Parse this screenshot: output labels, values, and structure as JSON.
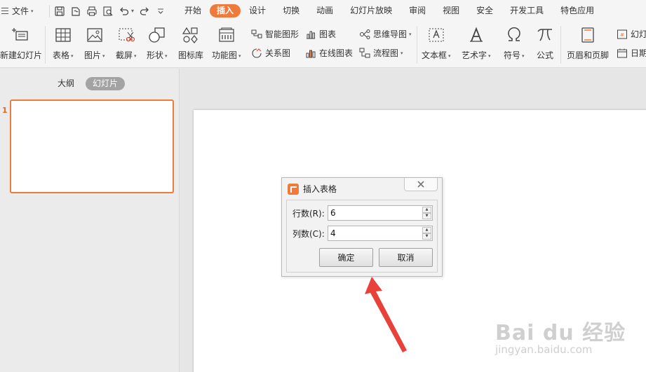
{
  "menubar": {
    "file_label": "文件",
    "tabs": [
      {
        "label": "开始"
      },
      {
        "label": "插入",
        "active": true
      },
      {
        "label": "设计"
      },
      {
        "label": "切换"
      },
      {
        "label": "动画"
      },
      {
        "label": "幻灯片放映"
      },
      {
        "label": "审阅"
      },
      {
        "label": "视图"
      },
      {
        "label": "安全"
      },
      {
        "label": "开发工具"
      },
      {
        "label": "特色应用"
      }
    ]
  },
  "ribbon": {
    "new_slide": "新建幻灯片",
    "table": "表格",
    "picture": "图片",
    "screenshot": "截屏",
    "shape": "形状",
    "icon_library": "图标库",
    "function_chart": "功能图",
    "smart_art": "智能图形",
    "chart": "图表",
    "relation_chart": "关系图",
    "online_chart": "在线图表",
    "mind_map": "思维导图",
    "flowchart": "流程图",
    "text_box": "文本框",
    "word_art": "艺术字",
    "symbol": "符号",
    "formula": "公式",
    "header_footer": "页眉和页脚",
    "slide_number": "幻灯",
    "date": "日期"
  },
  "leftpanel": {
    "tab_outline": "大纲",
    "tab_slides": "幻灯片",
    "slide_number": "1"
  },
  "dialog": {
    "title": "插入表格",
    "rows_label": "行数(R):",
    "rows_value": "6",
    "cols_label": "列数(C):",
    "cols_value": "4",
    "ok_label": "确定",
    "cancel_label": "取消"
  },
  "watermark": {
    "logo": "Bai du 经验",
    "url": "jingyan.baidu.com"
  },
  "colors": {
    "accent": "#ee7b3c",
    "arrow": "#e8413a"
  }
}
